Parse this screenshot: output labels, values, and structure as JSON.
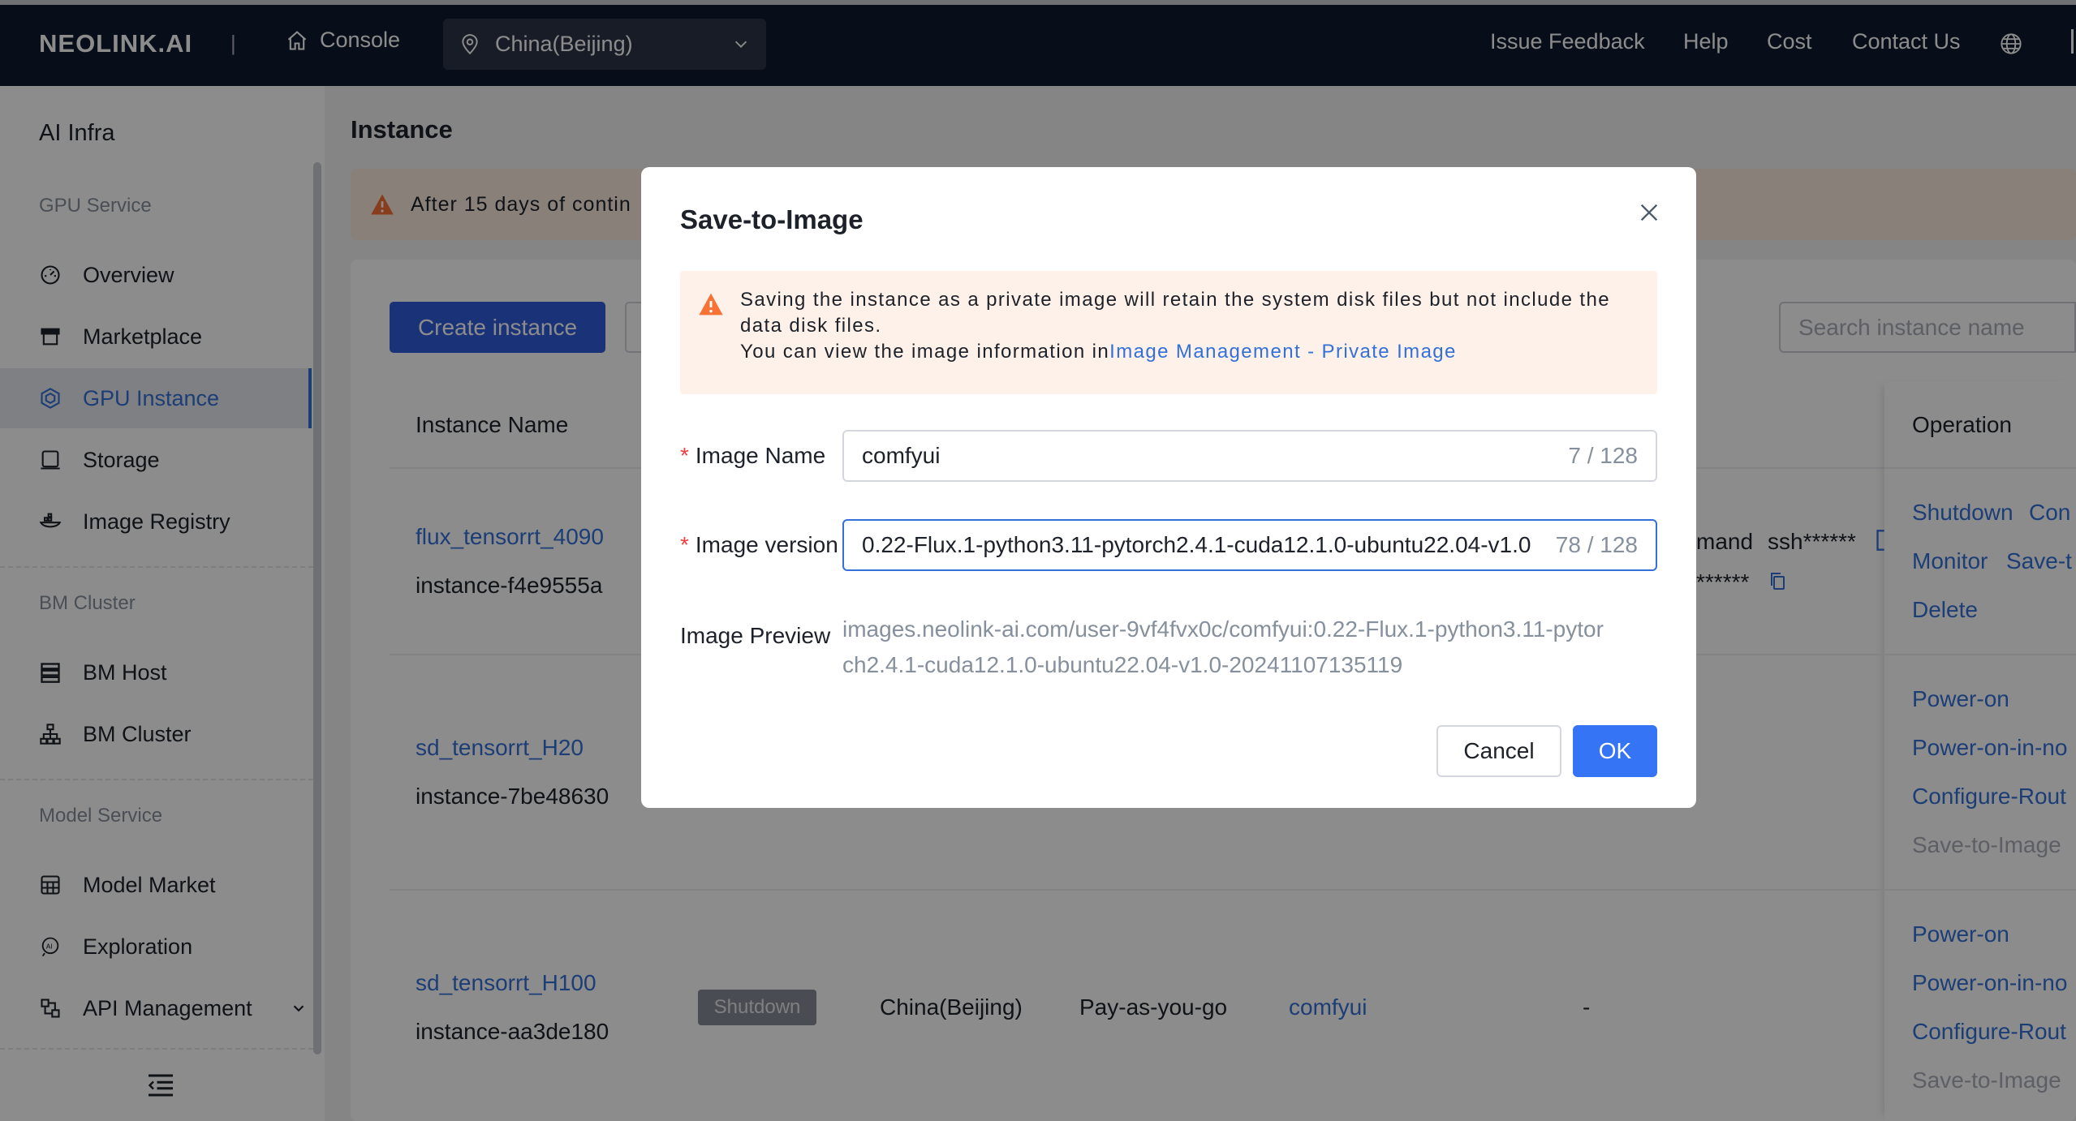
{
  "topbar": {
    "logo": "NEOLINK.AI",
    "separator": "|",
    "console_label": "Console",
    "region_value": "China(Beijing)",
    "links": [
      "Issue Feedback",
      "Help",
      "Cost",
      "Contact Us"
    ],
    "colors": {
      "bar": "#0f1a2e",
      "region_bg": "#2a3447"
    }
  },
  "sidebar": {
    "title": "AI Infra",
    "groups": [
      {
        "label": "GPU Service",
        "items": [
          {
            "label": "Overview",
            "icon": "dashboard-icon"
          },
          {
            "label": "Marketplace",
            "icon": "store-icon"
          },
          {
            "label": "GPU Instance",
            "icon": "gpu-icon",
            "active": true
          },
          {
            "label": "Storage",
            "icon": "storage-icon"
          },
          {
            "label": "Image Registry",
            "icon": "registry-icon"
          }
        ]
      },
      {
        "label": "BM Cluster",
        "items": [
          {
            "label": "BM Host",
            "icon": "server-icon"
          },
          {
            "label": "BM Cluster",
            "icon": "cluster-icon"
          }
        ]
      },
      {
        "label": "Model Service",
        "items": [
          {
            "label": "Model Market",
            "icon": "market-icon"
          },
          {
            "label": "Exploration",
            "icon": "ai-explore-icon"
          },
          {
            "label": "API Management",
            "icon": "api-icon",
            "expandable": true
          }
        ]
      }
    ],
    "active_color": "#3370d8"
  },
  "main": {
    "title": "Instance",
    "notice": "After 15 days of contin",
    "create_button": "Create instance",
    "search_placeholder": "Search instance name",
    "columns": {
      "name": "Instance Name",
      "operation": "Operation"
    },
    "rows": [
      {
        "name": "flux_tensorrt_4090",
        "id": "instance-f4e9555a",
        "command_fragment": "mand",
        "ssh_fragment": "ssh******",
        "password_fragment": "******",
        "ops": [
          "Shutdown",
          "Con",
          "Monitor",
          "Save-t",
          "Delete"
        ]
      },
      {
        "name": "sd_tensorrt_H20",
        "id": "instance-7be48630",
        "ops": [
          "Power-on",
          "Power-on-in-no",
          "Configure-Rout",
          "Save-to-Image"
        ]
      },
      {
        "name": "sd_tensorrt_H100",
        "id": "instance-aa3de180",
        "status": "Shutdown",
        "region": "China(Beijing)",
        "billing": "Pay-as-you-go",
        "image": "comfyui",
        "dash": "-",
        "ops": [
          "Power-on",
          "Power-on-in-no",
          "Configure-Rout",
          "Save-to-Image"
        ]
      }
    ]
  },
  "modal": {
    "title": "Save-to-Image",
    "alert_line1": "Saving the instance as a private image will retain the system disk files but not include the",
    "alert_line2": "data disk files.",
    "alert_line3_prefix": "You can view the image information in",
    "alert_link": "Image Management - Private Image",
    "image_name_label": "Image Name",
    "image_name_value": "comfyui",
    "image_name_count": "7 / 128",
    "image_version_label": "Image version",
    "image_version_value": "0.22-Flux.1-python3.11-pytorch2.4.1-cuda12.1.0-ubuntu22.04-v1.0",
    "image_version_count": "78 / 128",
    "preview_label": "Image Preview",
    "preview_line1": "images.neolink-ai.com/user-9vf4fvx0c/comfyui:0.22-Flux.1-python3.11-pytor",
    "preview_line2": "ch2.4.1-cuda12.1.0-ubuntu22.04-v1.0-20241107135119",
    "cancel_label": "Cancel",
    "ok_label": "OK",
    "colors": {
      "ok": "#3474f5",
      "alert_bg": "#fef1e9",
      "warning": "#f77234",
      "required": "#f53f3f"
    }
  }
}
